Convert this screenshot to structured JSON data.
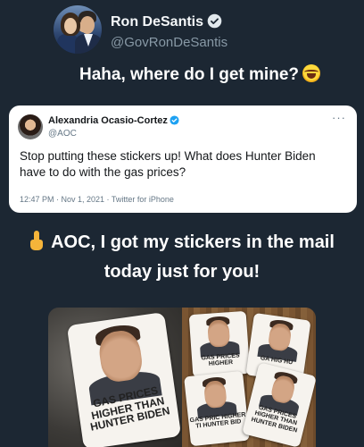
{
  "author": {
    "name": "Ron DeSantis",
    "handle": "@GovRonDeSantis",
    "verified_color": "#1da1f2"
  },
  "tweet": {
    "line1": "Haha, where do I get mine?",
    "line1_emoji": "face-with-tears-of-joy-icon",
    "line2": "AOC, I got my stickers in the mail today just for you!",
    "line2_emoji": "index-pointing-up-icon"
  },
  "quoted_tweet": {
    "name": "Alexandria Ocasio-Cortez",
    "handle": "@AOC",
    "more": "···",
    "text": "Stop putting these stickers up! What does Hunter Biden have to do with the gas prices?",
    "meta": "12:47 PM · Nov 1, 2021 · Twitter for iPhone"
  },
  "photo": {
    "big_sticker_text": "GAS PRICES HIGHER THAN HUNTER BIDEN",
    "sticker_text_1": "GAS PRICES HIGHER",
    "sticker_text_2": "GA HIG HU",
    "sticker_text_3": "GAS PRIC HIGHER TI HUNTER BID",
    "sticker_text_4": "GAS PRICES HIGHER THAN HUNTER BIDEN"
  },
  "colors": {
    "background": "#1c2733",
    "card": "#ffffff",
    "muted": "#8899a6"
  }
}
